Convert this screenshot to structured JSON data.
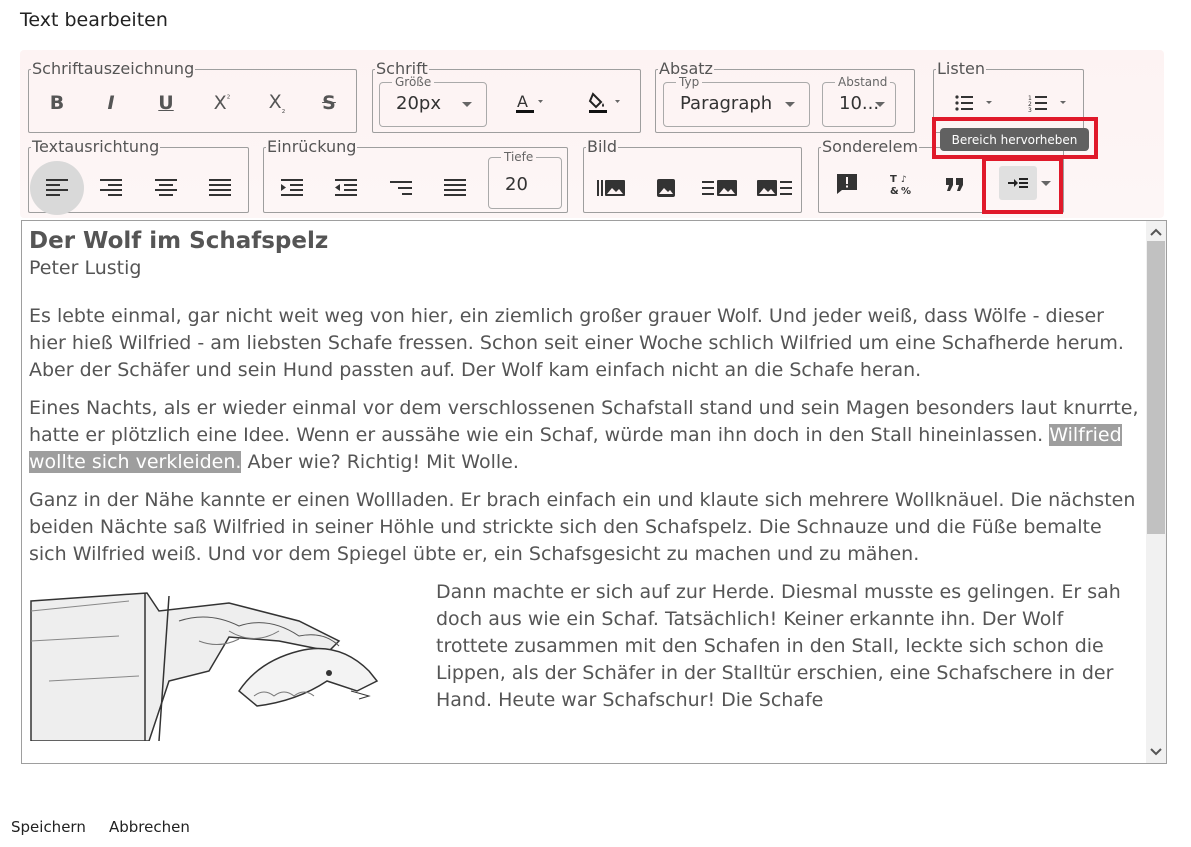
{
  "dialog": {
    "title": "Text bearbeiten"
  },
  "toolbar": {
    "formatting": {
      "legend": "Schriftauszeichnung"
    },
    "font": {
      "legend": "Schrift",
      "size_label": "Größe",
      "size_value": "20px"
    },
    "paragraph": {
      "legend": "Absatz",
      "type_label": "Typ",
      "type_value": "Paragraph",
      "spacing_label": "Abstand",
      "spacing_value": "10..."
    },
    "lists": {
      "legend": "Listen"
    },
    "alignment": {
      "legend": "Textausrichtung"
    },
    "indent": {
      "legend": "Einrückung",
      "depth_label": "Tiefe",
      "depth_value": "20"
    },
    "image": {
      "legend": "Bild"
    },
    "special": {
      "legend": "Sonderelem"
    },
    "tooltip": "Bereich hervorheben",
    "highlight_color": "#e0192a"
  },
  "document": {
    "title": "Der Wolf im Schafspelz",
    "author": "Peter Lustig",
    "p1": "Es lebte einmal, gar nicht weit weg von hier, ein ziemlich großer grauer Wolf. Und jeder weiß, dass Wölfe - dieser hier hieß Wilfried - am liebsten Schafe fressen. Schon seit einer Woche schlich Wilfried um eine Schafherde herum. Aber der Schäfer und sein Hund passten auf. Der Wolf kam einfach nicht an die Schafe heran.",
    "p2_before": "Eines Nachts, als er wieder einmal vor dem verschlossenen Schafstall stand und sein Magen besonders laut knurrte, hatte er plötzlich eine Idee. Wenn er aussähe wie ein Schaf, würde man ihn doch in den Stall hineinlassen. ",
    "p2_marked": "Wilfried wollte sich verkleiden.",
    "p2_after": " Aber wie? Richtig! Mit Wolle.",
    "p3": "Ganz in der Nähe kannte er einen Wollladen. Er brach einfach ein und klaute sich mehrere Wollknäuel. Die nächsten beiden Nächte saß Wilfried in seiner Höhle und strickte sich den Schafspelz. Die Schnauze und die Füße bemalte sich Wilfried weiß. Und vor dem Spiegel übte er, ein Schafsgesicht zu machen und zu mähen.",
    "p4": "Dann machte er sich auf zur Herde. Diesmal musste es gelingen. Er sah doch aus wie ein Schaf. Tatsächlich! Keiner erkannte ihn. Der Wolf trottete zusammen mit den Schafen in den Stall, leckte sich schon die Lippen, als der Schäfer in der Stalltür erschien, eine Schafschere in der Hand. Heute war Schafschur! Die Schafe"
  },
  "footer": {
    "save": "Speichern",
    "cancel": "Abbrechen"
  }
}
